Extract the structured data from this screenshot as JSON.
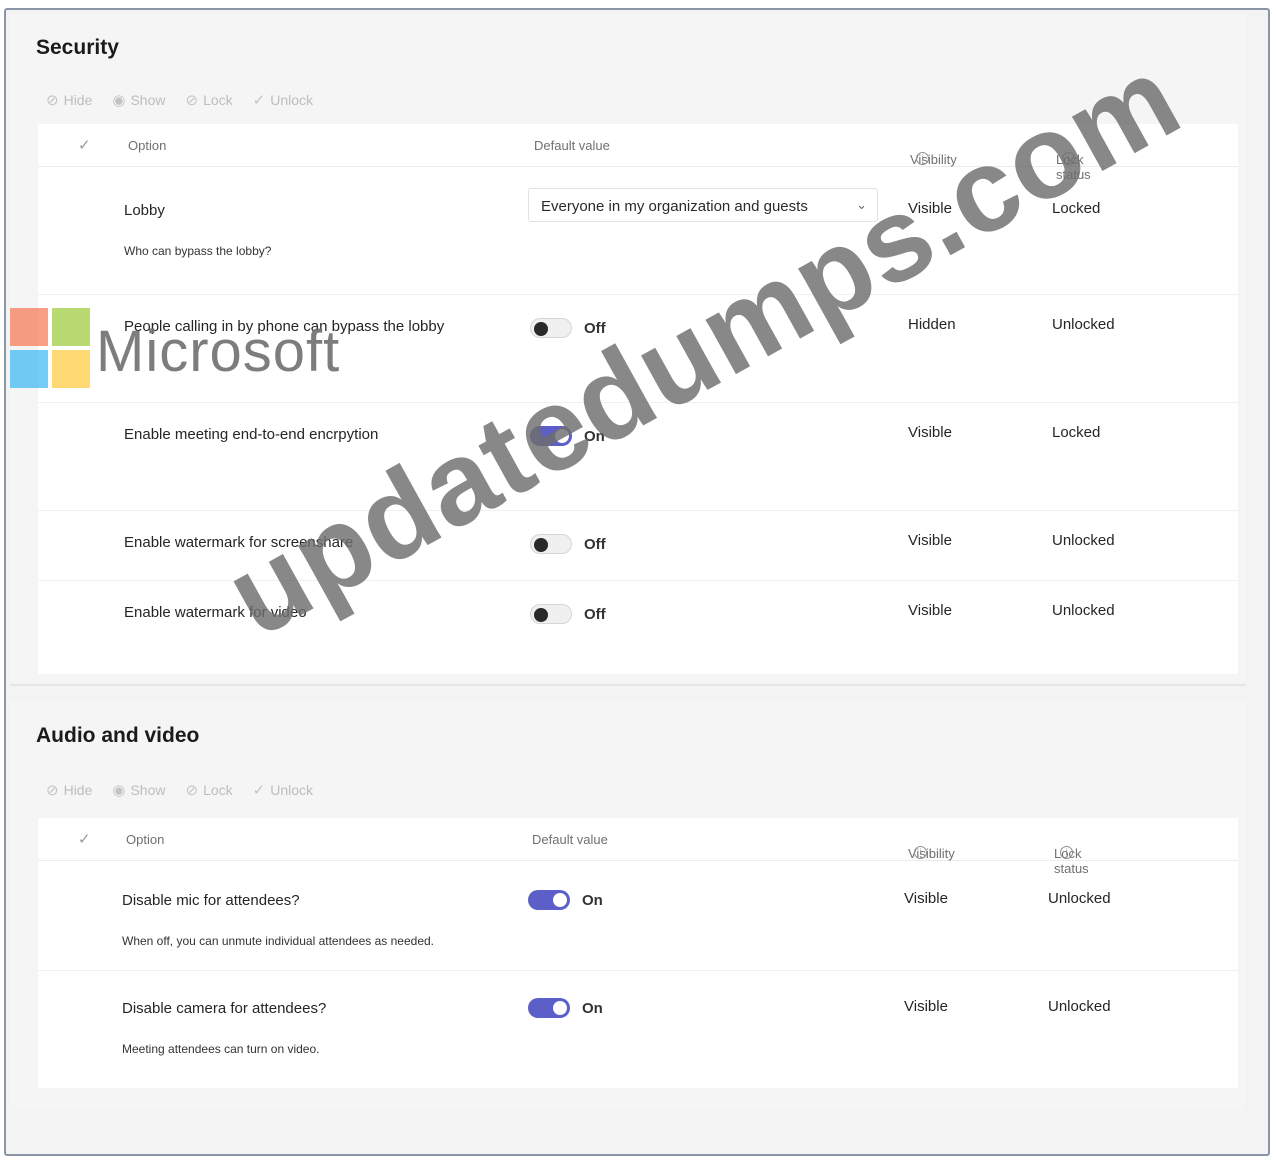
{
  "security": {
    "title": "Security",
    "toolbar": {
      "hide": "Hide",
      "show": "Show",
      "lock": "Lock",
      "unlock": "Unlock"
    },
    "columns": {
      "option": "Option",
      "default_value": "Default value",
      "visibility": "Visibility",
      "lock_status": "Lock status"
    },
    "rows": [
      {
        "option": "Lobby",
        "description": "Who can bypass the lobby?",
        "type": "select",
        "value": "Everyone in my organization and guests",
        "visibility": "Visible",
        "lock": "Locked"
      },
      {
        "option": "People calling in by phone can bypass the lobby",
        "type": "toggle",
        "value": "Off",
        "visibility": "Hidden",
        "lock": "Unlocked"
      },
      {
        "option": "Enable meeting end-to-end encrpytion",
        "type": "toggle",
        "value": "On",
        "visibility": "Visible",
        "lock": "Locked"
      },
      {
        "option": "Enable watermark for screenshare",
        "type": "toggle",
        "value": "Off",
        "visibility": "Visible",
        "lock": "Unlocked"
      },
      {
        "option": "Enable watermark for video",
        "type": "toggle",
        "value": "Off",
        "visibility": "Visible",
        "lock": "Unlocked"
      }
    ]
  },
  "audio_video": {
    "title": "Audio and video",
    "toolbar": {
      "hide": "Hide",
      "show": "Show",
      "lock": "Lock",
      "unlock": "Unlock"
    },
    "columns": {
      "option": "Option",
      "default_value": "Default value",
      "visibility": "Visibility",
      "lock_status": "Lock status"
    },
    "rows": [
      {
        "option": "Disable mic for attendees?",
        "description": "When off, you can unmute individual attendees as needed.",
        "type": "toggle",
        "value": "On",
        "visibility": "Visible",
        "lock": "Unlocked"
      },
      {
        "option": "Disable camera for attendees?",
        "description": "Meeting attendees can turn on video.",
        "type": "toggle",
        "value": "On",
        "visibility": "Visible",
        "lock": "Unlocked"
      }
    ]
  },
  "watermark": {
    "brand": "Microsoft",
    "site": "updatedumps.com"
  },
  "colors": {
    "accent": "#5b5fc7",
    "ms_red": "#f25022",
    "ms_green": "#7fba00",
    "ms_blue": "#00a4ef",
    "ms_yellow": "#ffb900"
  }
}
